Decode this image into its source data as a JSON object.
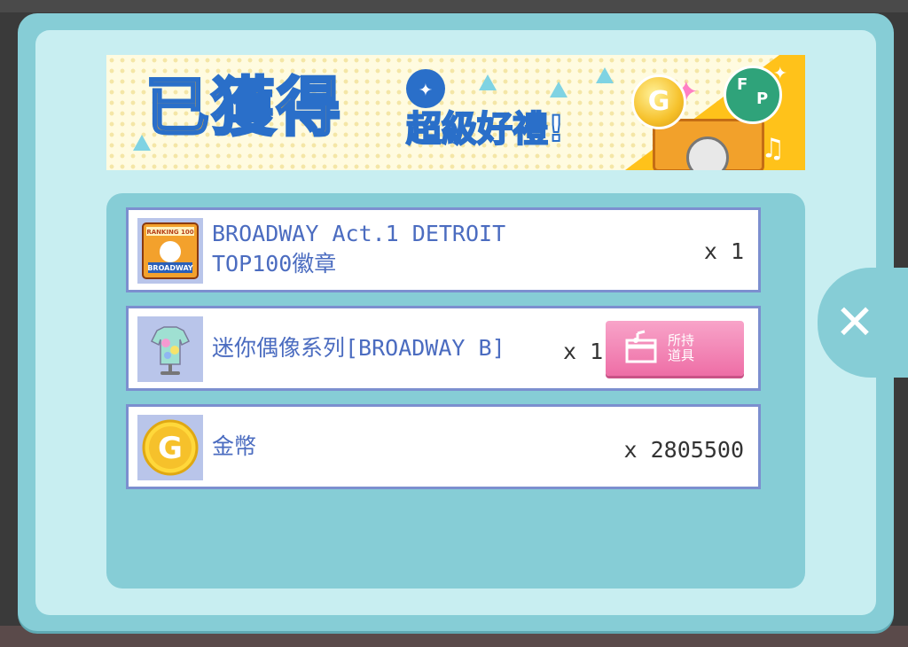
{
  "banner": {
    "title": "已獲得",
    "subtitle": "超級好禮!",
    "star_icon": "four-point-star",
    "coin_letter": "G",
    "clover_letters": [
      "F",
      "P"
    ]
  },
  "badge_art": {
    "top_text": "RANKING 100",
    "main_text": "BROADWAY"
  },
  "rewards": [
    {
      "name_line1": "BROADWAY Act.1 DETROIT",
      "name_line2": "TOP100徽章",
      "qty": "x 1",
      "icon": "badge-icon"
    },
    {
      "name_line1": "迷你偶像系列[BROADWAY B]",
      "qty": "x 1",
      "icon": "tshirt-icon",
      "button_label": "所持\n道具"
    },
    {
      "name_line1": "金幣",
      "qty": "x 2805500",
      "icon": "gold-coin-icon",
      "coin_letter": "G"
    }
  ],
  "close_label": "✕",
  "colors": {
    "modal": "#86cdd6",
    "inner": "#c8eef1",
    "name_text": "#4b6cc0",
    "row_border": "#7c8fcf",
    "pink_button": "#ee6ea6"
  }
}
